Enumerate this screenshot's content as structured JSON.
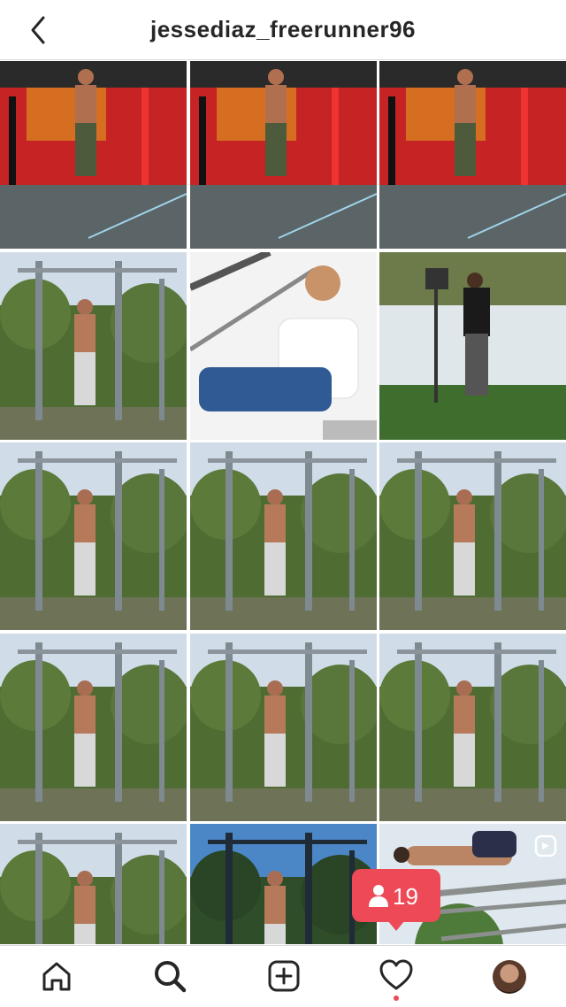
{
  "header": {
    "username": "jessediaz_freerunner96",
    "back_icon": "chevron-left-icon"
  },
  "grid": {
    "tiles": [
      {
        "scene": "gym-red",
        "reel": false
      },
      {
        "scene": "gym-red",
        "reel": false
      },
      {
        "scene": "gym-red",
        "reel": false
      },
      {
        "scene": "park-bars",
        "reel": false
      },
      {
        "scene": "portrait-stairs",
        "reel": false
      },
      {
        "scene": "park-walk",
        "reel": false
      },
      {
        "scene": "park-bars",
        "reel": false
      },
      {
        "scene": "park-bars",
        "reel": false
      },
      {
        "scene": "park-bars",
        "reel": false
      },
      {
        "scene": "park-bars",
        "reel": false
      },
      {
        "scene": "park-bars",
        "reel": false
      },
      {
        "scene": "park-bars",
        "reel": false
      },
      {
        "scene": "park-bars",
        "reel": false
      },
      {
        "scene": "park-bars-dark",
        "reel": false
      },
      {
        "scene": "human-flag",
        "reel": true
      }
    ]
  },
  "notification": {
    "icon": "person-icon",
    "count": "19",
    "color": "#ed4956"
  },
  "tabbar": {
    "items": [
      "home-icon",
      "search-icon",
      "new-post-icon",
      "activity-heart-icon",
      "profile-avatar"
    ],
    "active": "search-icon"
  }
}
